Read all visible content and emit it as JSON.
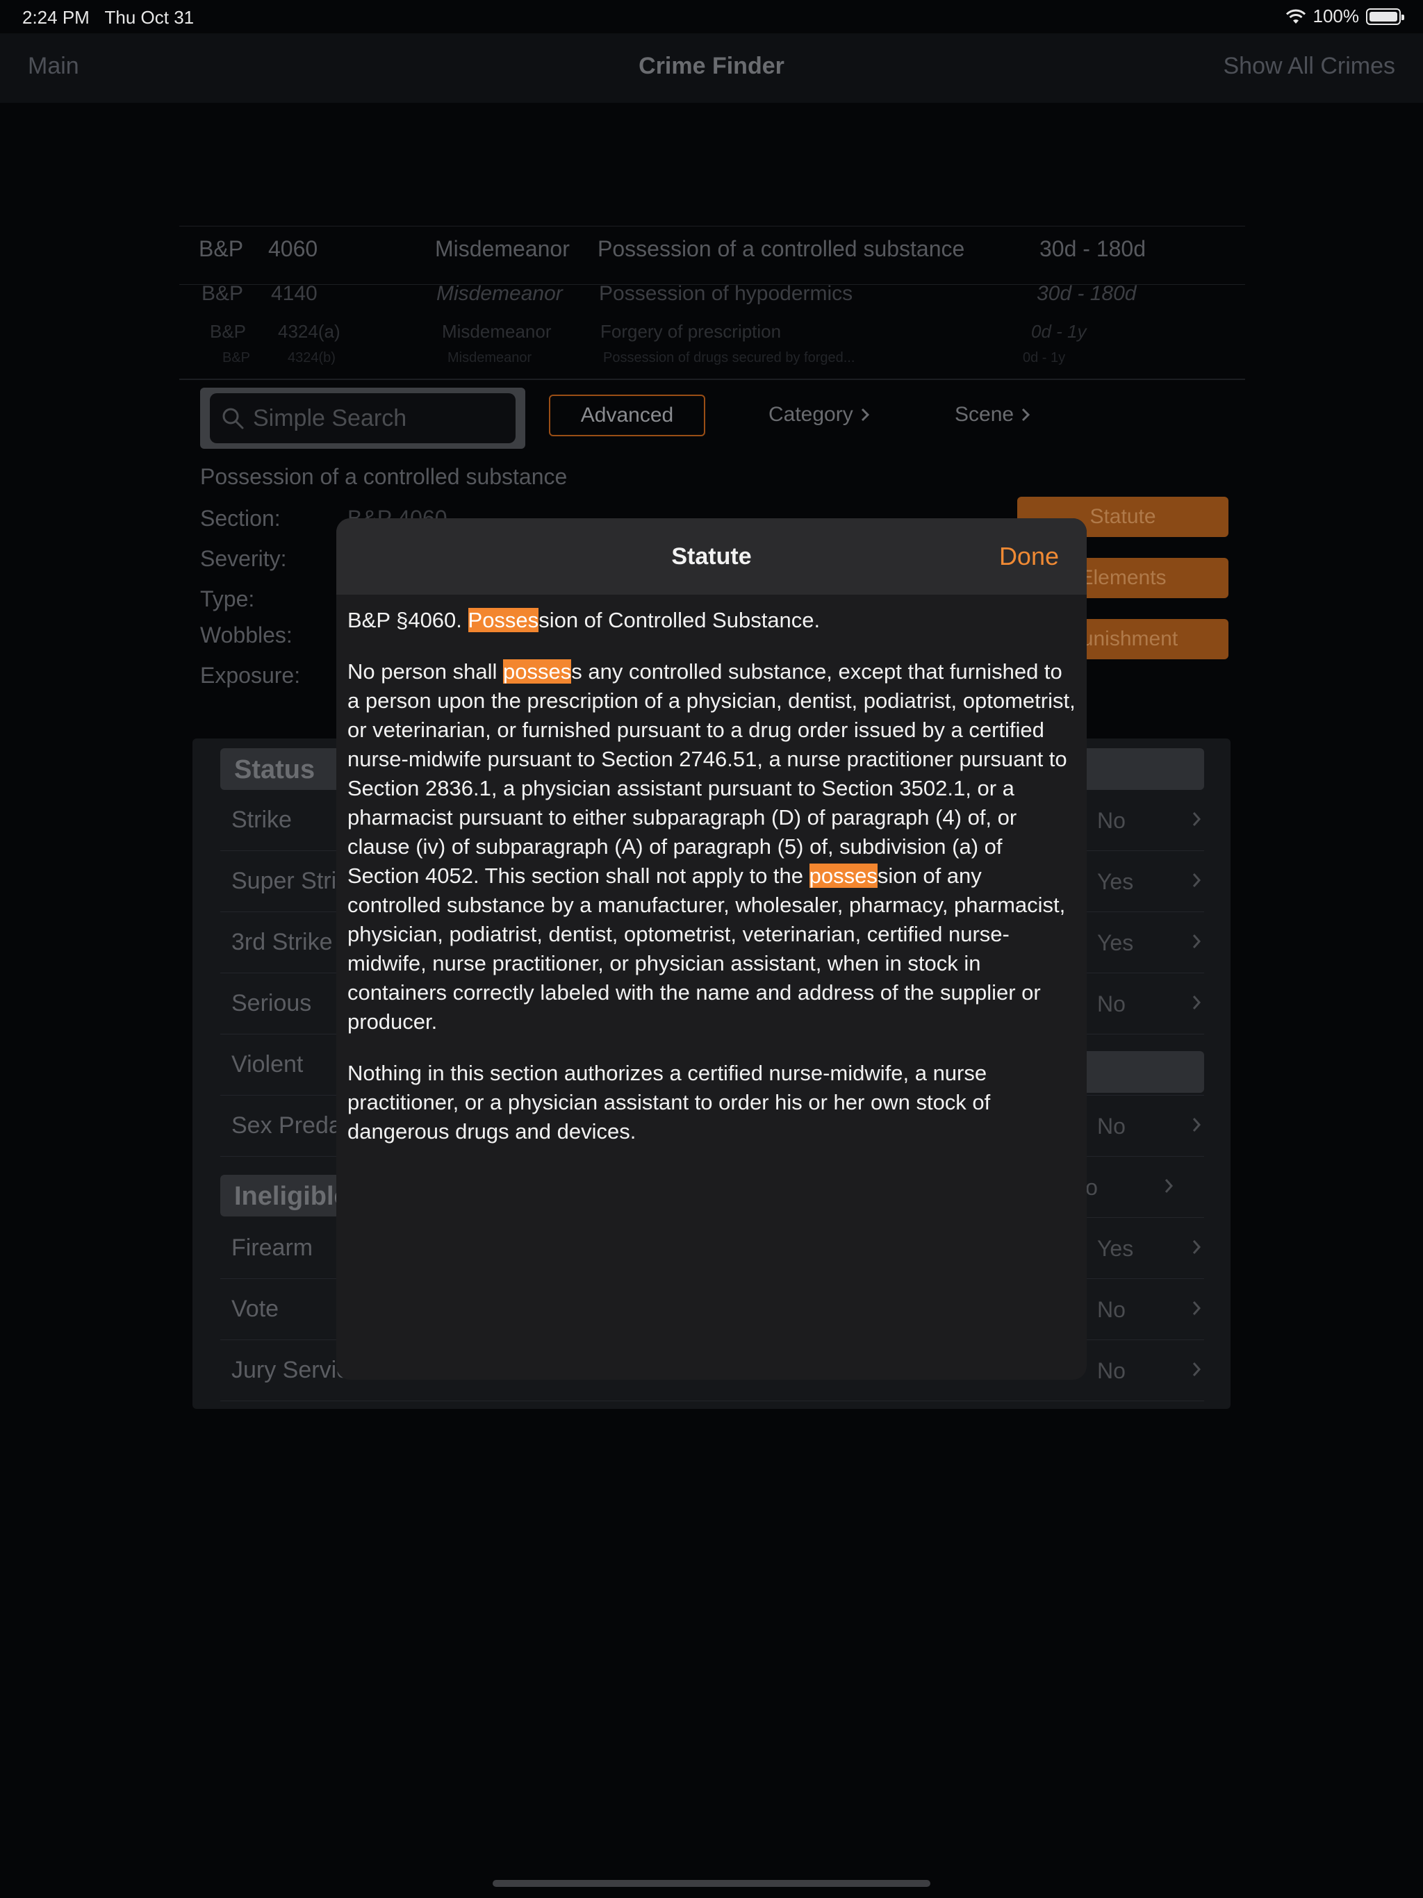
{
  "status_bar": {
    "time": "2:24 PM",
    "date": "Thu Oct 31",
    "battery": "100%",
    "battery_level": 1.0
  },
  "nav": {
    "left": "Main",
    "title": "Crime Finder",
    "right": "Show All Crimes"
  },
  "results": [
    {
      "code": "B&P",
      "section": "4060",
      "severity": "Misdemeanor",
      "description": "Possession of a controlled substance",
      "time": "30d - 180d"
    },
    {
      "code": "B&P",
      "section": "4140",
      "severity": "Misdemeanor",
      "description": "Possession of hypodermics",
      "time": "30d - 180d"
    },
    {
      "code": "B&P",
      "section": "4324(a)",
      "severity": "Misdemeanor",
      "description": "Forgery of prescription",
      "time": "0d - 1y"
    },
    {
      "code": "B&P",
      "section": "4324(b)",
      "severity": "Misdemeanor",
      "description": "Possession of drugs secured by forged...",
      "time": "0d - 1y"
    }
  ],
  "search": {
    "placeholder": "Simple Search",
    "advanced": "Advanced",
    "category": "Category",
    "scene": "Scene"
  },
  "detail": {
    "title": "Possession of a controlled substance",
    "section_label": "Section:",
    "section_value": "B&P 4060",
    "severity_label": "Severity:",
    "type_label": "Type:",
    "wobbles_label": "Wobbles:",
    "exposure_label": "Exposure:",
    "buttons": {
      "statute": "Statute",
      "elements": "Elements",
      "punishment": "Punishment"
    }
  },
  "status_section": {
    "header": "Status",
    "rows": [
      {
        "label": "Strike",
        "value": "No"
      },
      {
        "label": "Super Strike",
        "value": "Yes"
      },
      {
        "label": "3rd Strike",
        "value": "Yes"
      },
      {
        "label": "Serious",
        "value": "No"
      },
      {
        "label": "Violent",
        "value": ""
      },
      {
        "label": "Sex Predator",
        "value": "No"
      }
    ]
  },
  "ineligible_section": {
    "header": "Ineligible",
    "rows": [
      {
        "label": "",
        "value": "No"
      },
      {
        "label": "Firearm",
        "value": "Yes"
      },
      {
        "label": "Vote",
        "value": "No"
      },
      {
        "label": "Jury Service",
        "value": "No"
      }
    ]
  },
  "modal": {
    "title": "Statute",
    "done": "Done",
    "p1": {
      "pre": "B&P §4060. ",
      "hl": "Posses",
      "post": "sion of Controlled Substance."
    },
    "p2": {
      "pre": "No person shall ",
      "hl1": "posses",
      "mid": "s any controlled substance, except that furnished to a person upon the prescription of a physician, dentist, podiatrist, optometrist, or veterinarian, or furnished pursuant to a drug order issued by a certified nurse-midwife pursuant to Section 2746.51, a nurse practitioner pursuant to Section 2836.1, a physician assistant pursuant to Section 3502.1, or a pharmacist pursuant to either subparagraph (D) of paragraph (4) of, or clause (iv) of subparagraph (A) of paragraph (5) of, subdivision (a) of Section 4052. This section shall not apply to the ",
      "hl2": "posses",
      "post": "sion of any controlled substance by a manufacturer, wholesaler, pharmacy, pharmacist, physician, podiatrist, dentist, optometrist, veterinarian, certified nurse-midwife, nurse practitioner, or physician assistant, when in stock in containers correctly labeled with the name and address of the supplier or producer."
    },
    "p3": "Nothing in this section authorizes a certified nurse-midwife, a nurse practitioner, or a physician assistant to order his or her own stock of dangerous drugs and devices."
  },
  "colors": {
    "accent": "#f3862f",
    "background": "#050608",
    "modal_bg": "#1c1c1e"
  }
}
